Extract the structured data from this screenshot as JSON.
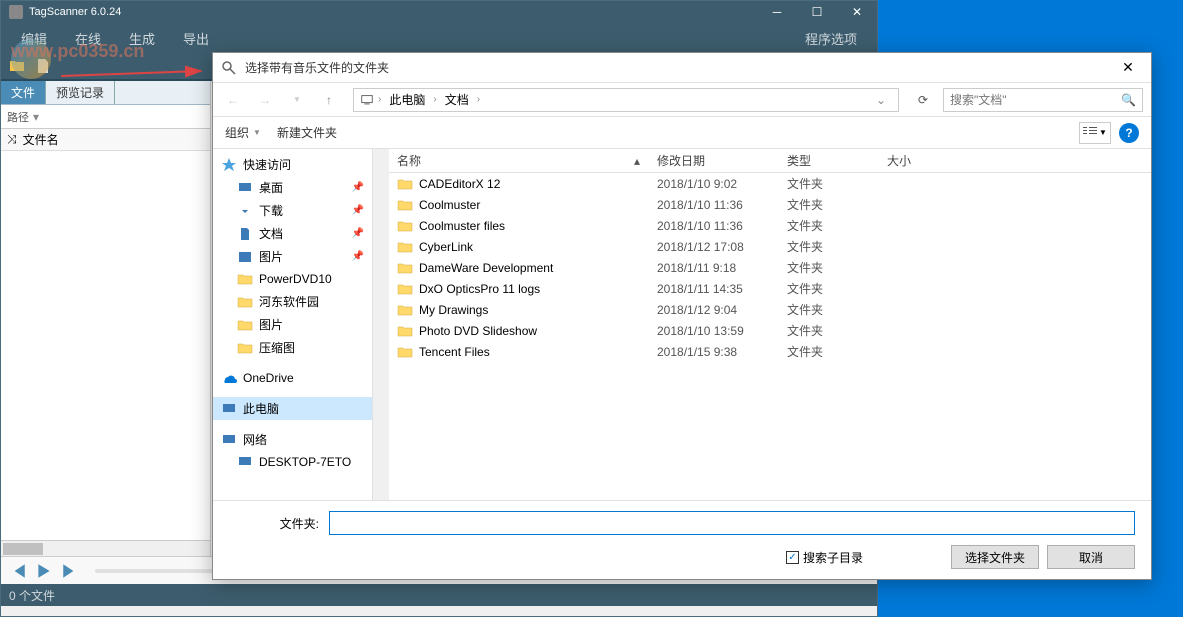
{
  "app": {
    "title": "TagScanner 6.0.24",
    "menu": {
      "edit": "编辑",
      "online": "在线",
      "gen": "生成",
      "export": "导出",
      "options": "程序选项"
    },
    "tabs": {
      "file": "文件",
      "preview": "预览记录"
    },
    "path_label": "路径",
    "col_shuffle": "⤨",
    "col_filename": "文件名",
    "status": "0 个文件"
  },
  "watermark": "www.pc0359.cn",
  "dialog": {
    "title": "选择带有音乐文件的文件夹",
    "breadcrumb": {
      "pc": "此电脑",
      "docs": "文档"
    },
    "search_placeholder": "搜索\"文档\"",
    "toolbar": {
      "organize": "组织",
      "newfolder": "新建文件夹"
    },
    "columns": {
      "name": "名称",
      "date": "修改日期",
      "type": "类型",
      "size": "大小"
    },
    "tree": {
      "quick": "快速访问",
      "desktop": "桌面",
      "downloads": "下载",
      "documents": "文档",
      "pictures": "图片",
      "powerdvd": "PowerDVD10",
      "hedong": "河东软件园",
      "pics2": "图片",
      "compress": "压缩图",
      "onedrive": "OneDrive",
      "thispc": "此电脑",
      "network": "网络",
      "desktop7": "DESKTOP-7ETO"
    },
    "files": [
      {
        "name": "CADEditorX 12",
        "date": "2018/1/10 9:02",
        "type": "文件夹"
      },
      {
        "name": "Coolmuster",
        "date": "2018/1/10 11:36",
        "type": "文件夹"
      },
      {
        "name": "Coolmuster files",
        "date": "2018/1/10 11:36",
        "type": "文件夹"
      },
      {
        "name": "CyberLink",
        "date": "2018/1/12 17:08",
        "type": "文件夹"
      },
      {
        "name": "DameWare Development",
        "date": "2018/1/11 9:18",
        "type": "文件夹"
      },
      {
        "name": "DxO OpticsPro 11 logs",
        "date": "2018/1/11 14:35",
        "type": "文件夹"
      },
      {
        "name": "My Drawings",
        "date": "2018/1/12 9:04",
        "type": "文件夹"
      },
      {
        "name": "Photo DVD Slideshow",
        "date": "2018/1/10 13:59",
        "type": "文件夹"
      },
      {
        "name": "Tencent Files",
        "date": "2018/1/15 9:38",
        "type": "文件夹"
      }
    ],
    "footer": {
      "folder_label": "文件夹:",
      "search_sub": "搜索子目录",
      "select": "选择文件夹",
      "cancel": "取消"
    }
  }
}
